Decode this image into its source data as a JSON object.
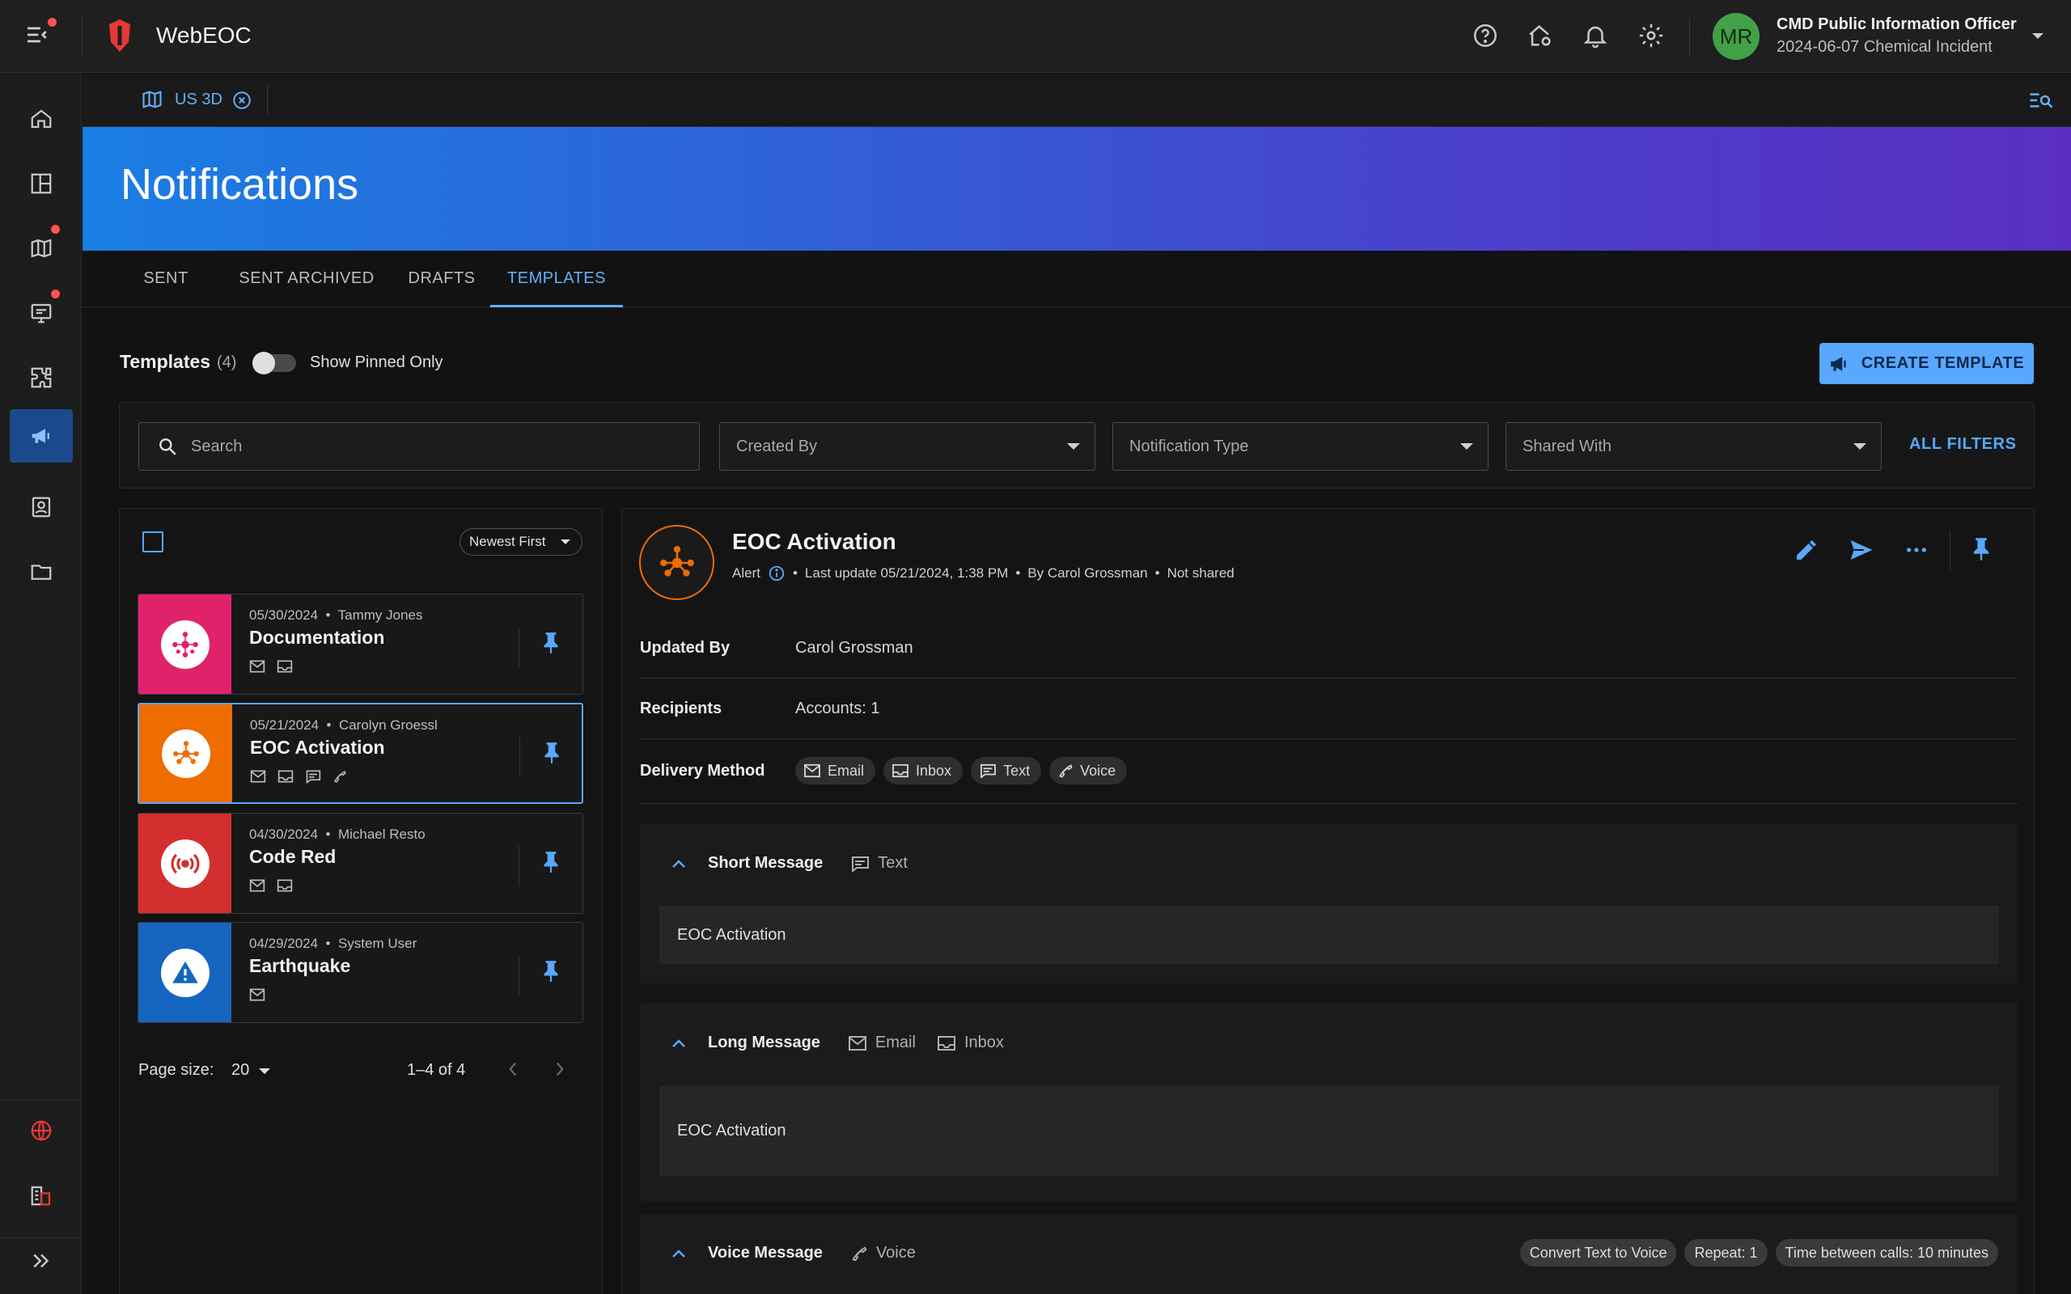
{
  "app": {
    "title": "WebEOC"
  },
  "user": {
    "initials": "MR",
    "name": "CMD Public Information Officer",
    "incident": "2024-06-07 Chemical Incident"
  },
  "tabstrip": {
    "tab_label": "US 3D"
  },
  "banner": {
    "title": "Notifications"
  },
  "subtabs": [
    {
      "label": "SENT"
    },
    {
      "label": "SENT ARCHIVED"
    },
    {
      "label": "DRAFTS"
    },
    {
      "label": "TEMPLATES"
    }
  ],
  "templates": {
    "heading": "Templates",
    "count": "(4)",
    "pinned_toggle_label": "Show Pinned Only",
    "create_button": "CREATE TEMPLATE"
  },
  "filters": {
    "search_placeholder": "Search",
    "created_by": "Created By",
    "notification_type": "Notification Type",
    "shared_with": "Shared With",
    "all_filters": "ALL FILTERS"
  },
  "list": {
    "sort_label": "Newest First",
    "cards": [
      {
        "date": "05/30/2024",
        "author": "Tammy Jones",
        "title": "Documentation",
        "color": "#e0226b"
      },
      {
        "date": "05/21/2024",
        "author": "Carolyn Groessl",
        "title": "EOC Activation",
        "color": "#ef6c00"
      },
      {
        "date": "04/30/2024",
        "author": "Michael Resto",
        "title": "Code Red",
        "color": "#d32f2f"
      },
      {
        "date": "04/29/2024",
        "author": "System User",
        "title": "Earthquake",
        "color": "#1565c0"
      }
    ],
    "page_size_label": "Page size:",
    "page_size": "20",
    "range": "1–4 of 4"
  },
  "detail": {
    "title": "EOC Activation",
    "type": "Alert",
    "last_update": "Last update 05/21/2024, 1:38 PM",
    "by": "By Carol Grossman",
    "shared": "Not shared",
    "updated_by_label": "Updated By",
    "updated_by": "Carol Grossman",
    "recipients_label": "Recipients",
    "recipients": "Accounts: 1",
    "delivery_label": "Delivery Method",
    "delivery": [
      "Email",
      "Inbox",
      "Text",
      "Voice"
    ],
    "short_message": {
      "heading": "Short Message",
      "tag": "Text",
      "body": "EOC Activation"
    },
    "long_message": {
      "heading": "Long Message",
      "tag_email": "Email",
      "tag_inbox": "Inbox",
      "body": "EOC Activation"
    },
    "voice_message": {
      "heading": "Voice Message",
      "tag": "Voice",
      "pills": [
        "Convert Text to Voice",
        "Repeat: 1",
        "Time between calls: 10 minutes"
      ]
    }
  },
  "colors": {
    "accent": "#58a8ff",
    "brand_red": "#e53935",
    "selected_tab": "#64b0ff"
  }
}
